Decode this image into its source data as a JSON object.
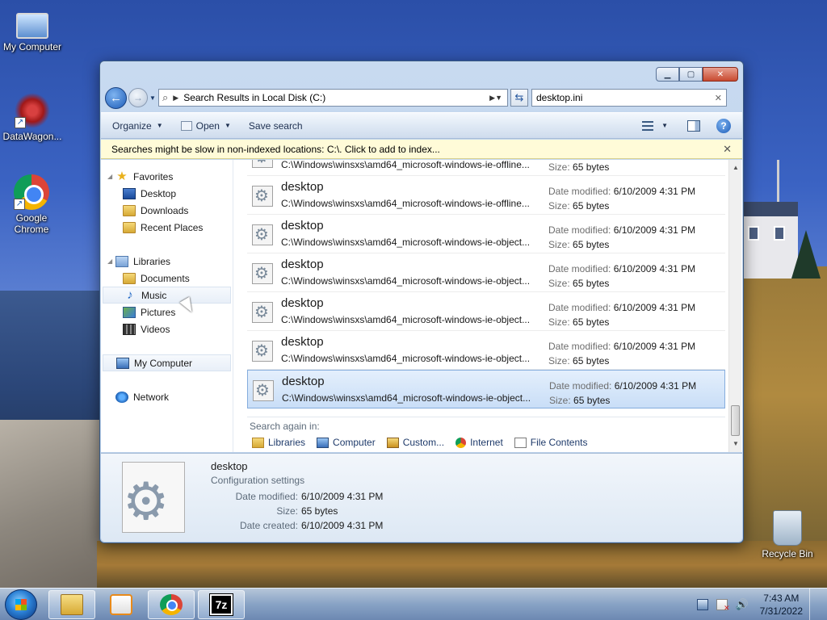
{
  "desktop": {
    "icons": [
      {
        "label": "My Computer"
      },
      {
        "label": "DataWagon..."
      },
      {
        "label": "Google Chrome"
      },
      {
        "label": "Recycle Bin"
      }
    ]
  },
  "window": {
    "address": {
      "crumb": "Search Results in Local Disk (C:)"
    },
    "search": {
      "value": "desktop.ini"
    },
    "toolbar": {
      "organize": "Organize",
      "open": "Open",
      "save_search": "Save search"
    },
    "infobar": {
      "text": "Searches might be slow in non-indexed locations: C:\\. Click to add to index...",
      "close": "✕"
    },
    "nav": {
      "favorites": "Favorites",
      "desktop": "Desktop",
      "downloads": "Downloads",
      "recent": "Recent Places",
      "libraries": "Libraries",
      "documents": "Documents",
      "music": "Music",
      "pictures": "Pictures",
      "videos": "Videos",
      "my_computer": "My Computer",
      "network": "Network"
    },
    "results": {
      "partial": {
        "path": "C:\\Windows\\winsxs\\amd64_microsoft-windows-ie-offline...",
        "size_label": "Size:",
        "size": "65 bytes"
      },
      "items": [
        {
          "name": "desktop",
          "path": "C:\\Windows\\winsxs\\amd64_microsoft-windows-ie-offline...",
          "date_label": "Date modified:",
          "date": "6/10/2009 4:31 PM",
          "size_label": "Size:",
          "size": "65 bytes"
        },
        {
          "name": "desktop",
          "path": "C:\\Windows\\winsxs\\amd64_microsoft-windows-ie-object...",
          "date_label": "Date modified:",
          "date": "6/10/2009 4:31 PM",
          "size_label": "Size:",
          "size": "65 bytes"
        },
        {
          "name": "desktop",
          "path": "C:\\Windows\\winsxs\\amd64_microsoft-windows-ie-object...",
          "date_label": "Date modified:",
          "date": "6/10/2009 4:31 PM",
          "size_label": "Size:",
          "size": "65 bytes"
        },
        {
          "name": "desktop",
          "path": "C:\\Windows\\winsxs\\amd64_microsoft-windows-ie-object...",
          "date_label": "Date modified:",
          "date": "6/10/2009 4:31 PM",
          "size_label": "Size:",
          "size": "65 bytes"
        },
        {
          "name": "desktop",
          "path": "C:\\Windows\\winsxs\\amd64_microsoft-windows-ie-object...",
          "date_label": "Date modified:",
          "date": "6/10/2009 4:31 PM",
          "size_label": "Size:",
          "size": "65 bytes"
        },
        {
          "name": "desktop",
          "path": "C:\\Windows\\winsxs\\amd64_microsoft-windows-ie-object...",
          "date_label": "Date modified:",
          "date": "6/10/2009 4:31 PM",
          "size_label": "Size:",
          "size": "65 bytes"
        }
      ],
      "selected_index": 5
    },
    "search_again": {
      "label": "Search again in:",
      "items": [
        "Libraries",
        "Computer",
        "Custom...",
        "Internet",
        "File Contents"
      ]
    },
    "details": {
      "name": "desktop",
      "type": "Configuration settings",
      "date_modified_label": "Date modified:",
      "date_modified": "6/10/2009 4:31 PM",
      "size_label": "Size:",
      "size": "65 bytes",
      "date_created_label": "Date created:",
      "date_created": "6/10/2009 4:31 PM"
    }
  },
  "taskbar": {
    "apps": [
      "Windows Explorer",
      "Media Player",
      "Google Chrome",
      "7-Zip"
    ],
    "seven_zip_label": "7z",
    "time": "7:43 AM",
    "date": "7/31/2022"
  },
  "colors": {
    "accent": "#1c5cb8",
    "selection": "#c9def7",
    "infobar": "#fffbd8"
  }
}
